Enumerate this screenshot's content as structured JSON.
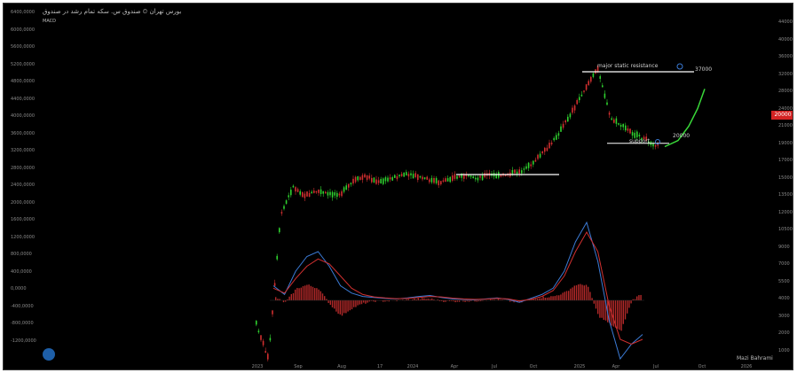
{
  "header": {
    "title": "بورس تهران ⏲ صندوق س. سکه تمام رشد در صندوق",
    "indicator_label": "MACD"
  },
  "footer": {
    "source": "Mazi Bahrami"
  },
  "price_tag": "20000",
  "annotations": {
    "resistance_label": "major static resistance",
    "resistance_value": "37000",
    "support_label": "support",
    "support_value": "20000"
  },
  "colors": {
    "background": "#000000",
    "up_candle": "#2fd12f",
    "down_candle": "#d12f2f",
    "projection": "#39d839",
    "macd_line": "#3b7bd6",
    "signal_line": "#d13030",
    "level_line": "#ffffff",
    "price_tag": "#d32323"
  },
  "axes": {
    "left_ticks": [
      "6400,0000",
      "6000,0000",
      "5600,0000",
      "5200,0000",
      "4800,0000",
      "4400,0000",
      "4000,0000",
      "3600,0000",
      "3200,0000",
      "2800,0000",
      "2400,0000",
      "2000,0000",
      "1600,0000",
      "1200,0000",
      "800,0000",
      "400,0000",
      "0,0000",
      "-400,0000",
      "-800,0000",
      "-1200,0000"
    ],
    "right_ticks": [
      "44000",
      "40000",
      "36000",
      "32000",
      "28000",
      "24000",
      "21000",
      "19000",
      "17000",
      "15000",
      "13500",
      "12000",
      "10500",
      "9000",
      "7000",
      "5500",
      "4000",
      "3000",
      "2000",
      "1000"
    ],
    "x_ticks": [
      "2023",
      "Sep",
      "Aug",
      "17",
      "2024",
      "Apr",
      "Jul",
      "Oct",
      "2025",
      "Apr",
      "Jul",
      "Oct",
      "2026"
    ]
  },
  "chart_data": [
    {
      "type": "line",
      "subtype": "candlestick",
      "title": "",
      "x_range": [
        "2023",
        "2026"
      ],
      "ylim": [
        1000,
        44000
      ],
      "y_scale": "log",
      "trend_y": [
        5500,
        4200,
        12500,
        15500,
        14500,
        15000,
        14600,
        14800,
        16200,
        16800,
        16000,
        16500,
        17000,
        16800,
        16400,
        16000,
        16600,
        16800,
        16500,
        17000,
        16800,
        17200,
        17600,
        19200,
        21000,
        24000,
        28000,
        33000,
        38000,
        26000,
        24500,
        23000,
        22000,
        21000
      ],
      "levels": [
        {
          "name": "major static resistance",
          "value": 37000
        },
        {
          "name": "support",
          "value": 20000
        },
        {
          "name": "",
          "value": 17000
        }
      ],
      "projection": [
        21000,
        22000,
        24500,
        28000,
        32500
      ]
    },
    {
      "type": "line",
      "subtype": "macd",
      "series": [
        {
          "name": "MACD",
          "values": [
            300,
            120,
            600,
            900,
            1000,
            700,
            300,
            150,
            80,
            60,
            40,
            30,
            50,
            80,
            100,
            60,
            30,
            20,
            10,
            30,
            50,
            20,
            -40,
            40,
            120,
            250,
            600,
            1200,
            1600,
            800,
            -400,
            -1200,
            -900,
            -700
          ]
        },
        {
          "name": "Signal",
          "values": [
            250,
            150,
            450,
            700,
            850,
            750,
            500,
            250,
            120,
            70,
            50,
            35,
            40,
            60,
            80,
            70,
            45,
            30,
            20,
            25,
            40,
            30,
            -10,
            20,
            80,
            200,
            500,
            1000,
            1400,
            1000,
            -100,
            -800,
            -900,
            -800
          ]
        }
      ],
      "ylim": [
        -1200,
        1700
      ]
    }
  ]
}
